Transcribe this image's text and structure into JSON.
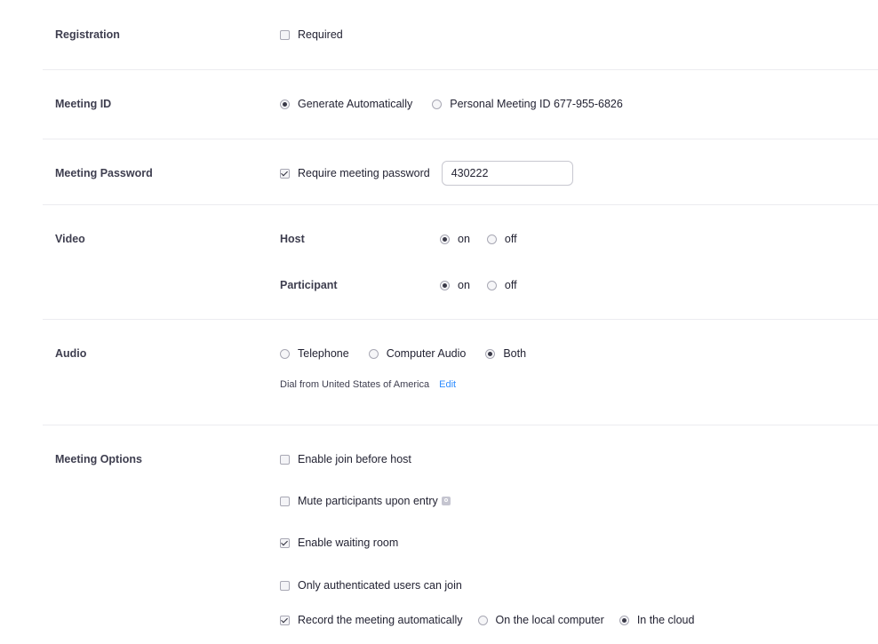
{
  "registration": {
    "label": "Registration",
    "required_label": "Required",
    "required_checked": false
  },
  "meeting_id": {
    "label": "Meeting ID",
    "options": [
      {
        "label": "Generate Automatically",
        "selected": true
      },
      {
        "label": "Personal Meeting ID 677-955-6826",
        "selected": false
      }
    ]
  },
  "meeting_password": {
    "label": "Meeting Password",
    "require_label": "Require meeting password",
    "require_checked": true,
    "value": "430222"
  },
  "video": {
    "label": "Video",
    "host": {
      "label": "Host",
      "on_label": "on",
      "off_label": "off",
      "value": "on"
    },
    "participant": {
      "label": "Participant",
      "on_label": "on",
      "off_label": "off",
      "value": "on"
    }
  },
  "audio": {
    "label": "Audio",
    "options": [
      {
        "label": "Telephone",
        "selected": false
      },
      {
        "label": "Computer Audio",
        "selected": false
      },
      {
        "label": "Both",
        "selected": true
      }
    ],
    "dial_text": "Dial from United States of America",
    "edit_label": "Edit"
  },
  "meeting_options": {
    "label": "Meeting Options",
    "join_before_host": {
      "label": "Enable join before host",
      "checked": false
    },
    "mute_on_entry": {
      "label": "Mute participants upon entry",
      "checked": false
    },
    "waiting_room": {
      "label": "Enable waiting room",
      "checked": true
    },
    "authenticated_only": {
      "label": "Only authenticated users can join",
      "checked": false
    },
    "record_auto": {
      "label": "Record the meeting automatically",
      "checked": true,
      "options": [
        {
          "label": "On the local computer",
          "selected": false
        },
        {
          "label": "In the cloud",
          "selected": true
        }
      ]
    }
  },
  "colors": {
    "link": "#2d8cff",
    "label_text": "#3e3e4f",
    "body_text": "#232333",
    "divider": "#ececf0"
  },
  "icons": {
    "info": "info-icon"
  }
}
